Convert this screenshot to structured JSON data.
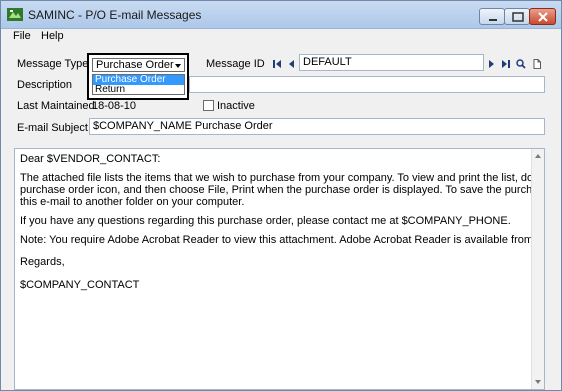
{
  "window": {
    "title": "SAMINC - P/O E-mail Messages"
  },
  "menu": {
    "file": "File",
    "help": "Help"
  },
  "form": {
    "message_type_label": "Message Type",
    "message_type_value": "Purchase Order",
    "message_type_options": [
      "Purchase Order",
      "Return"
    ],
    "message_id_label": "Message ID",
    "message_id_value": "DEFAULT",
    "description_label": "Description",
    "description_value": "",
    "last_maintained_label": "Last Maintained",
    "last_maintained_value": "18-08-10",
    "inactive_label": "Inactive",
    "inactive_checked": false,
    "email_subject_label": "E-mail Subject",
    "email_subject_value": "$COMPANY_NAME Purchase Order"
  },
  "message_body": [
    "Dear $VENDOR_CONTACT:",
    "The attached file lists the items that we wish to purchase from your company. To view and print the list, double-click on the",
    "purchase order icon, and then choose File, Print when the purchase order is displayed. To save the purchase order, copy it from",
    "this e-mail to another folder on your computer.",
    "If you have any questions regarding this purchase order, please contact me at $COMPANY_PHONE.",
    "Note:  You require Adobe Acrobat Reader to view this attachment. Adobe Acrobat Reader is available from www.adobe.com",
    "Regards,",
    "$COMPANY_CONTACT"
  ]
}
